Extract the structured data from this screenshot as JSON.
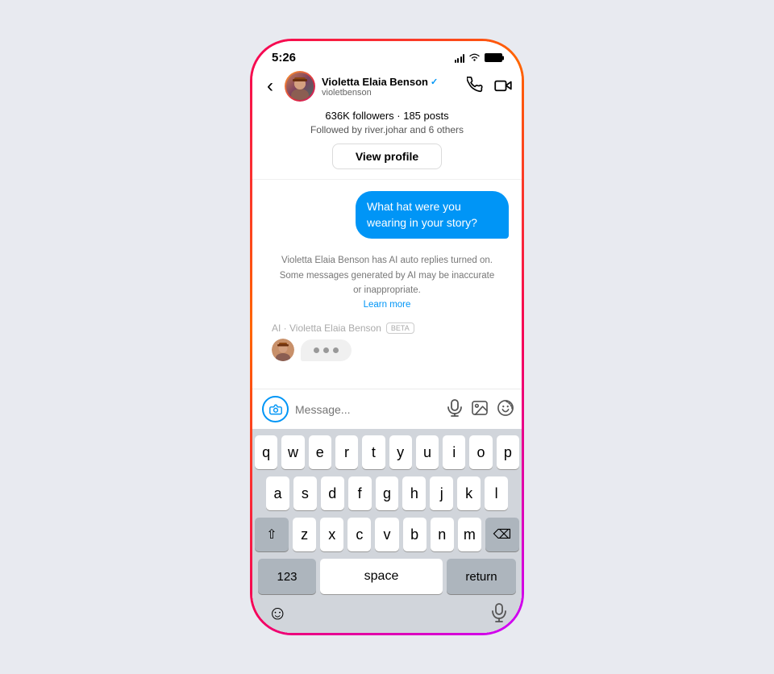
{
  "status_bar": {
    "time": "5:26",
    "signal": "signal",
    "wifi": "wifi",
    "battery": "battery"
  },
  "header": {
    "back_label": "‹",
    "user_name": "Violetta Elaia Benson",
    "username": "violetbenson",
    "verified": "✓",
    "call_icon": "phone",
    "video_icon": "video"
  },
  "profile_info": {
    "stats": "636K followers · 185 posts",
    "followed_by": "Followed by river.johar and 6 others",
    "view_profile_label": "View profile"
  },
  "messages": [
    {
      "type": "outgoing",
      "text": "What hat were you wearing in your story?"
    }
  ],
  "ai_notice": {
    "text": "Violetta Elaia Benson has AI auto replies turned on. Some messages generated by AI may be inaccurate or inappropriate.",
    "learn_more": "Learn more"
  },
  "ai_label": {
    "text": "AI · Violetta Elaia Benson",
    "badge": "BETA"
  },
  "input": {
    "placeholder": "Message...",
    "camera_icon": "camera",
    "mic_icon": "mic",
    "gallery_icon": "gallery",
    "sticker_icon": "sticker"
  },
  "keyboard": {
    "rows": [
      [
        "q",
        "w",
        "e",
        "r",
        "t",
        "y",
        "u",
        "i",
        "o",
        "p"
      ],
      [
        "a",
        "s",
        "d",
        "f",
        "g",
        "h",
        "j",
        "k",
        "l"
      ],
      [
        "z",
        "x",
        "c",
        "v",
        "b",
        "n",
        "m"
      ]
    ],
    "special": {
      "shift": "⇧",
      "delete": "⌫",
      "numbers": "123",
      "space": "space",
      "return": "return",
      "emoji": "☺",
      "mic": "🎤"
    }
  }
}
